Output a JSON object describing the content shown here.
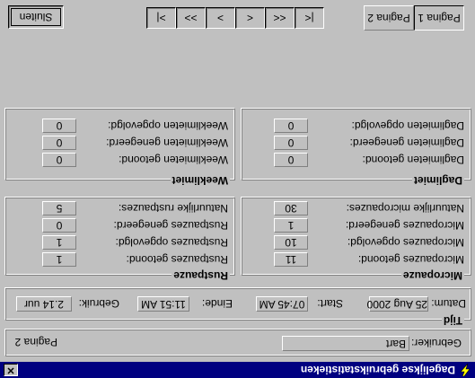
{
  "window": {
    "title": "Dagelijkse gebruikstatistieken",
    "close_label": "✕"
  },
  "user": {
    "label": "Gebruiker:",
    "value": "Bart",
    "page_label": "Pagina 2"
  },
  "tijd": {
    "legend": "Tijd",
    "datum_label": "Datum:",
    "datum_value": "25 Aug 2000",
    "start_label": "Start:",
    "start_value": "07:45 AM",
    "einde_label": "Einde:",
    "einde_value": "11:51 AM",
    "gebruik_label": "Gebruik:",
    "gebruik_value": "2.14 uur"
  },
  "micropauze": {
    "legend": "Micropauze",
    "rows": [
      {
        "label": "Micropauzes getoond:",
        "value": "11"
      },
      {
        "label": "Micropauzes opgevolgd:",
        "value": "10"
      },
      {
        "label": "Micropauzes genegeerd:",
        "value": "1"
      },
      {
        "label": "Natuurlijke micropauzes:",
        "value": "30"
      }
    ]
  },
  "rustpauze": {
    "legend": "Rustpauze",
    "rows": [
      {
        "label": "Rustpauzes getoond:",
        "value": "1"
      },
      {
        "label": "Rustpauzes opgevolgd:",
        "value": "1"
      },
      {
        "label": "Rustpauzes genegeerd:",
        "value": "0"
      },
      {
        "label": "Natuurlijke rustpauzes:",
        "value": "5"
      }
    ]
  },
  "daglimiet": {
    "legend": "Daglimiet",
    "rows": [
      {
        "label": "Daglimieten getoond:",
        "value": "0"
      },
      {
        "label": "Daglimieten genegeerd:",
        "value": "0"
      },
      {
        "label": "Daglimieten opgevolgd:",
        "value": "0"
      }
    ]
  },
  "weeklimiet": {
    "legend": "Weeklimiet",
    "rows": [
      {
        "label": "Weeklimieten getoond:",
        "value": "0"
      },
      {
        "label": "Weeklimieten genegeerd:",
        "value": "0"
      },
      {
        "label": "Weeklimieten opgevolgd:",
        "value": "0"
      }
    ]
  },
  "toolbar": {
    "tab1": "Pagina 1",
    "tab2": "Pagina 2",
    "first": "|<",
    "prev_page": "<<",
    "prev": "<",
    "next": ">",
    "next_page": ">>",
    "last": ">|",
    "close": "Sluiten"
  }
}
